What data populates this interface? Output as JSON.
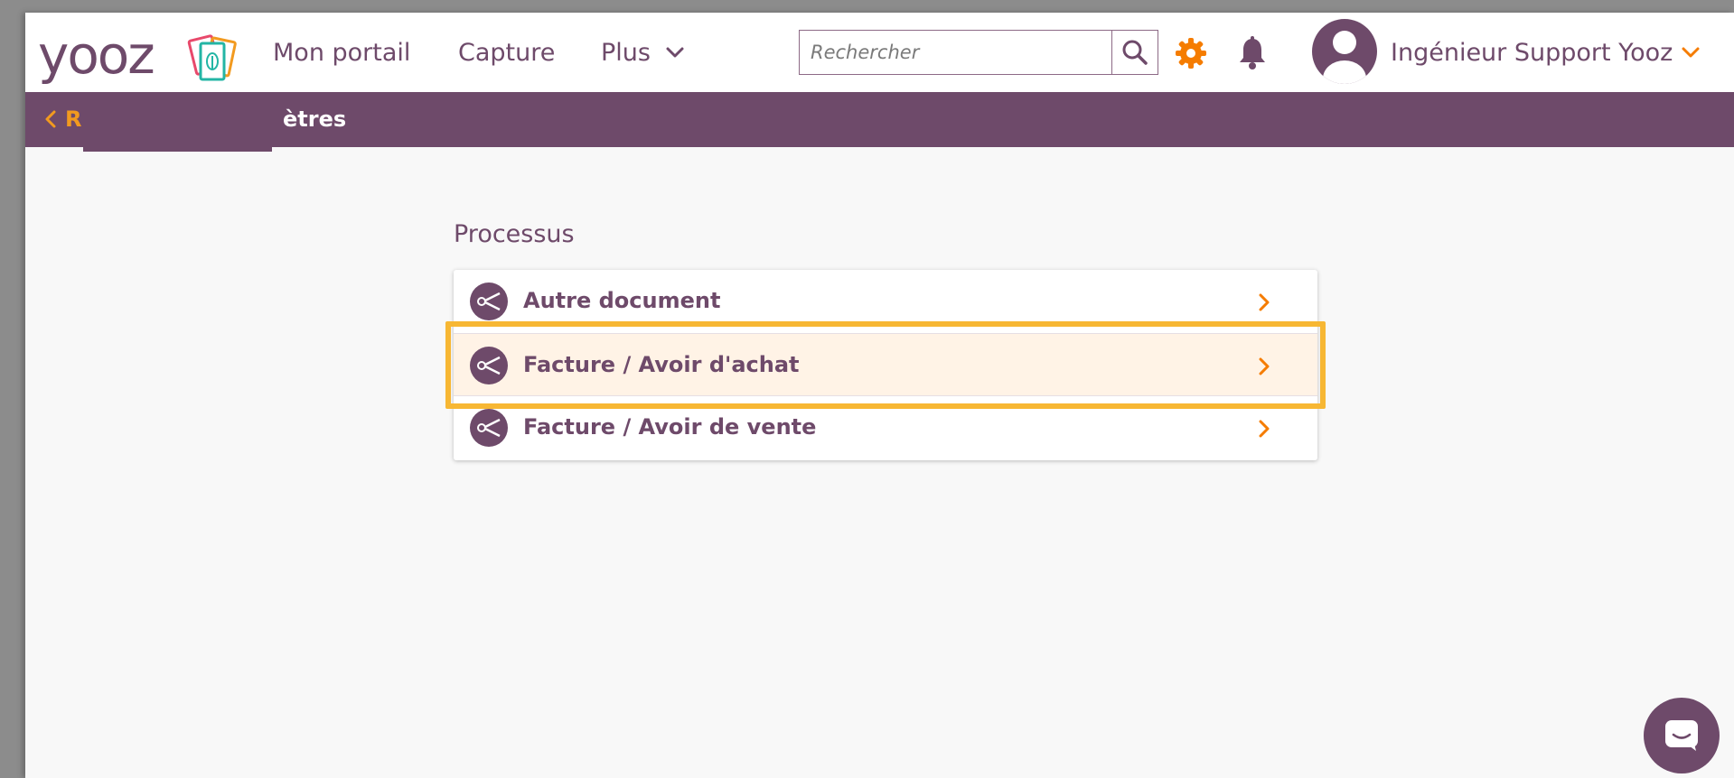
{
  "brand": {
    "logo_text": "yooz",
    "primary_color": "#6e4a6a",
    "accent_color": "#f29a1f",
    "highlight_color": "#f7b733"
  },
  "header": {
    "nav": [
      {
        "label": "Mon portail"
      },
      {
        "label": "Capture"
      },
      {
        "label": "Plus",
        "icon": "chevron-down-icon"
      }
    ],
    "search": {
      "placeholder": "Rechercher",
      "value": "",
      "icon": "search-icon"
    },
    "settings_icon": "gear-icon",
    "notifications_icon": "bell-icon",
    "user": {
      "name": "Ingénieur Support Yooz",
      "avatar_icon": "user-avatar-icon",
      "menu_icon": "chevron-down-icon"
    }
  },
  "breadcrumb": {
    "back_label": "R",
    "back_icon": "chevron-left-icon",
    "current": "ètres"
  },
  "main": {
    "section_title": "Processus",
    "items": [
      {
        "label": "Autre document",
        "icon": "share-icon",
        "arrow_icon": "chevron-right-icon",
        "highlighted": false
      },
      {
        "label": "Facture / Avoir d'achat",
        "icon": "share-icon",
        "arrow_icon": "chevron-right-icon",
        "highlighted": true
      },
      {
        "label": "Facture / Avoir de vente",
        "icon": "share-icon",
        "arrow_icon": "chevron-right-icon",
        "highlighted": false
      }
    ]
  },
  "chat": {
    "icon": "chat-icon"
  }
}
